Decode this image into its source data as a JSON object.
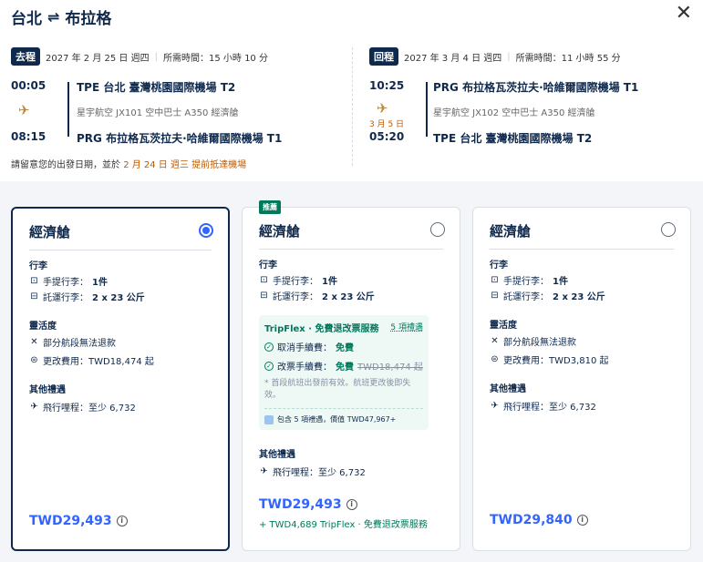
{
  "header": {
    "origin": "台北",
    "destination": "布拉格",
    "swap_icon": "⇌",
    "close_icon": "✕"
  },
  "outbound": {
    "badge": "去程",
    "date": "2027 年 2 月 25 日 週四",
    "duration": "所需時間：15 小時 10 分",
    "dep_time": "00:05",
    "dep_airport": "TPE 台北 臺灣桃園國際機場 T2",
    "flight_info": "星宇航空  JX101  空中巴士 A350  經濟艙",
    "arr_time": "08:15",
    "arr_airport": "PRG 布拉格瓦茨拉夫·哈維爾國際機場 T1"
  },
  "return": {
    "badge": "回程",
    "date": "2027 年 3 月 4 日 週四",
    "duration": "所需時間：11 小時 55 分",
    "dep_time": "10:25",
    "dep_airport": "PRG 布拉格瓦茨拉夫·哈維爾國際機場 T1",
    "flight_info": "星宇航空  JX102  空中巴士 A350  經濟艙",
    "next_day": "3 月 5 日",
    "arr_time": "05:20",
    "arr_airport": "TPE 台北 臺灣桃園國際機場 T2"
  },
  "notice": {
    "prefix": "請留意您的出發日期，並於",
    "highlight": "2 月 24 日 週三 提前抵達機場"
  },
  "cards": [
    {
      "name": "經濟艙",
      "baggage_title": "行李",
      "carry_on_label": "手提行李：",
      "carry_on_value": "1件",
      "checked_label": "託運行李：",
      "checked_value": "2 x 23 公斤",
      "flex_title": "靈活度",
      "refund": "部分航段無法退款",
      "change": "更改費用：TWD18,474 起",
      "other_title": "其他禮遇",
      "miles": "飛行哩程：至少 6,732",
      "price": "TWD29,493"
    },
    {
      "badge": "推薦",
      "name": "經濟艙",
      "baggage_title": "行李",
      "carry_on_label": "手提行李：",
      "carry_on_value": "1件",
      "checked_label": "託運行李：",
      "checked_value": "2 x 23 公斤",
      "tripflex_title": "TripFlex · 免費退改票服務",
      "tripflex_perks": "5 項禮遇",
      "cancel_label": "取消手續費：",
      "cancel_value": "免費",
      "change_label": "改票手續費：",
      "change_value": "免費",
      "change_old": "TWD18,474 起",
      "note": "* 首段航班出發前有效。航班更改後即失效。",
      "perks_foot": "包含 5 項禮遇，價值 TWD47,967+",
      "other_title": "其他禮遇",
      "miles": "飛行哩程：至少 6,732",
      "price": "TWD29,493",
      "addon": "+ TWD4,689 TripFlex · 免費退改票服務"
    },
    {
      "name": "經濟艙",
      "baggage_title": "行李",
      "carry_on_label": "手提行李：",
      "carry_on_value": "1件",
      "checked_label": "託運行李：",
      "checked_value": "2 x 23 公斤",
      "flex_title": "靈活度",
      "refund": "部分航段無法退款",
      "change": "更改費用：TWD3,810 起",
      "other_title": "其他禮遇",
      "miles": "飛行哩程：至少 6,732",
      "price": "TWD29,840"
    }
  ],
  "icons": {
    "luggage": "luggage-icon",
    "suitcase": "suitcase-icon",
    "cross": "cross-icon",
    "exchange": "exchange-icon",
    "miles": "plane-icon",
    "info": "info-icon",
    "check": "check-circle-icon",
    "gift": "gift-icon",
    "airline": "starlux-logo"
  },
  "colors": {
    "primary": "#0f294d",
    "accent": "#3264ff",
    "green": "#00795b",
    "orange": "#c05a00"
  }
}
